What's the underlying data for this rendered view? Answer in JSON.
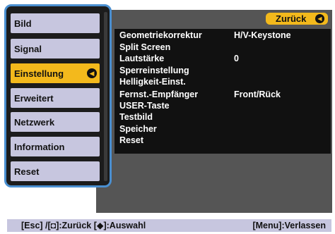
{
  "sidebar": {
    "items": [
      {
        "label": "Bild"
      },
      {
        "label": "Signal"
      },
      {
        "label": "Einstellung",
        "arrow": "◀"
      },
      {
        "label": "Erweitert"
      },
      {
        "label": "Netzwerk"
      },
      {
        "label": "Information"
      },
      {
        "label": "Reset"
      }
    ]
  },
  "header": {
    "back_label": "Zurück",
    "back_arrow": "◀"
  },
  "settings": {
    "rows": [
      {
        "label": "Geometriekorrektur",
        "value": "H/V-Keystone"
      },
      {
        "label": "Split Screen",
        "value": ""
      },
      {
        "label": "Lautstärke",
        "value": "0"
      },
      {
        "label": "Sperreinstellung",
        "value": ""
      },
      {
        "label": "Helligkeit-Einst.",
        "value": ""
      },
      {
        "label": "Fernst.-Empfänger",
        "value": "Front/Rück"
      },
      {
        "label": "USER-Taste",
        "value": ""
      },
      {
        "label": "Testbild",
        "value": ""
      },
      {
        "label": "Speicher",
        "value": ""
      },
      {
        "label": "Reset",
        "value": ""
      }
    ]
  },
  "footer": {
    "left_hint": "[Esc] /[◘]:Zurück  [◆]:Auswahl",
    "right_hint": "[Menu]:Verlassen"
  },
  "colors": {
    "selected": "#f3b91c",
    "item_bg": "#c7c6df",
    "focus_border": "#4a8fd0",
    "panel_bg": "#555555",
    "list_bg": "#111111"
  }
}
